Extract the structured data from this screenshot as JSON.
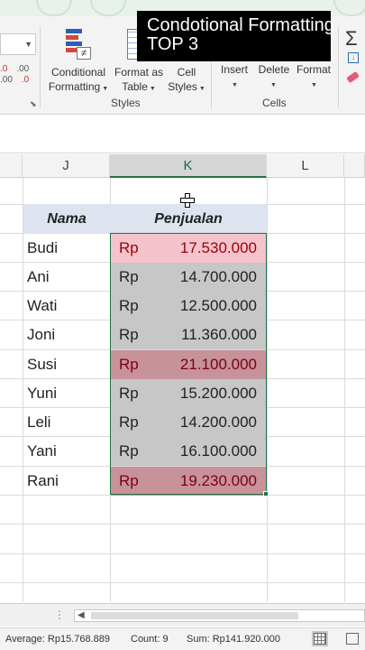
{
  "overlay": {
    "line1": "Condotional Formatting",
    "line2": "TOP 3"
  },
  "ribbon": {
    "styles": {
      "conditional_formatting": [
        "Conditional",
        "Formatting"
      ],
      "format_as_table": [
        "Format as",
        "Table"
      ],
      "cell_styles": [
        "Cell",
        "Styles"
      ],
      "group_label": "Styles"
    },
    "cells": {
      "insert": "Insert",
      "delete": "Delete",
      "format": "Format",
      "group_label": "Cells"
    },
    "number_icons": [
      ".0",
      ".00",
      ".00",
      ".0"
    ]
  },
  "columns": [
    "J",
    "K",
    "L"
  ],
  "selected_column": "K",
  "table": {
    "headers": {
      "name": "Nama",
      "sales": "Penjualan"
    },
    "currency": "Rp",
    "rows": [
      {
        "name": "Budi",
        "amount": "17.530.000",
        "format": "light-red"
      },
      {
        "name": "Ani",
        "amount": "14.700.000",
        "format": "gray"
      },
      {
        "name": "Wati",
        "amount": "12.500.000",
        "format": "gray"
      },
      {
        "name": "Joni",
        "amount": "11.360.000",
        "format": "gray"
      },
      {
        "name": "Susi",
        "amount": "21.100.000",
        "format": "dark-red"
      },
      {
        "name": "Yuni",
        "amount": "15.200.000",
        "format": "gray"
      },
      {
        "name": "Leli",
        "amount": "14.200.000",
        "format": "gray"
      },
      {
        "name": "Yani",
        "amount": "16.100.000",
        "format": "gray"
      },
      {
        "name": "Rani",
        "amount": "19.230.000",
        "format": "dark-red"
      }
    ],
    "colors": {
      "header_bg": "#dde4f0",
      "light_red": "#f4c3cc",
      "gray": "#c7c7c7",
      "dark_red": "#c8929b",
      "selection": "#217346"
    }
  },
  "status": {
    "average": "Average:  Rp15.768.889",
    "count": "Count: 9",
    "sum": "Sum:  Rp141.920.000"
  }
}
